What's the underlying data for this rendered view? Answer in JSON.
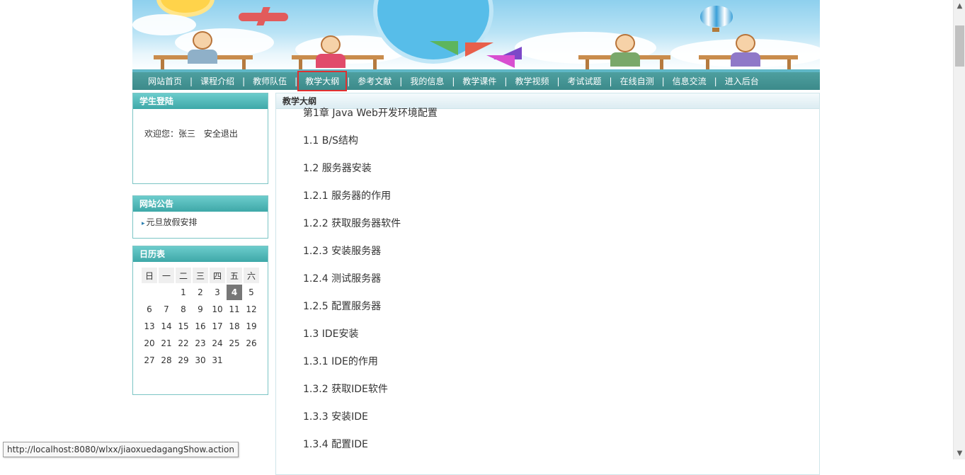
{
  "nav": {
    "items": [
      "网站首页",
      "课程介绍",
      "教师队伍",
      "教学大纲",
      "参考文献",
      "我的信息",
      "教学课件",
      "教学视频",
      "考试试题",
      "在线自测",
      "信息交流",
      "进入后台"
    ],
    "separator": "|",
    "active_index": 3
  },
  "login_box": {
    "title": "学生登陆",
    "welcome": "欢迎您：张三",
    "logout": "安全退出"
  },
  "notice_box": {
    "title": "网站公告",
    "items": [
      "元旦放假安排"
    ]
  },
  "calendar": {
    "title": "日历表",
    "weekdays": [
      "日",
      "一",
      "二",
      "三",
      "四",
      "五",
      "六"
    ],
    "weeks": [
      [
        "",
        "",
        "1",
        "2",
        "3",
        "4",
        "5"
      ],
      [
        "6",
        "7",
        "8",
        "9",
        "10",
        "11",
        "12"
      ],
      [
        "13",
        "14",
        "15",
        "16",
        "17",
        "18",
        "19"
      ],
      [
        "20",
        "21",
        "22",
        "23",
        "24",
        "25",
        "26"
      ],
      [
        "27",
        "28",
        "29",
        "30",
        "31",
        "",
        ""
      ]
    ],
    "today": "4"
  },
  "content": {
    "title": "教学大纲",
    "lines": [
      "第1章 Java Web开发环境配置",
      "1.1 B/S结构",
      "1.2 服务器安装",
      "1.2.1 服务器的作用",
      "1.2.2 获取服务器软件",
      "1.2.3 安装服务器",
      "1.2.4 测试服务器",
      "1.2.5 配置服务器",
      "1.3 IDE安装",
      "1.3.1 IDE的作用",
      "1.3.2 获取IDE软件",
      "1.3.3 安装IDE",
      "1.3.4 配置IDE"
    ]
  },
  "status_bar": {
    "url": "http://localhost:8080/wlxx/jiaoxuedagangShow.action"
  },
  "colors": {
    "nav_bg": "#438f8f",
    "box_header": "#4ab3b3",
    "active_outline": "#e03030"
  }
}
